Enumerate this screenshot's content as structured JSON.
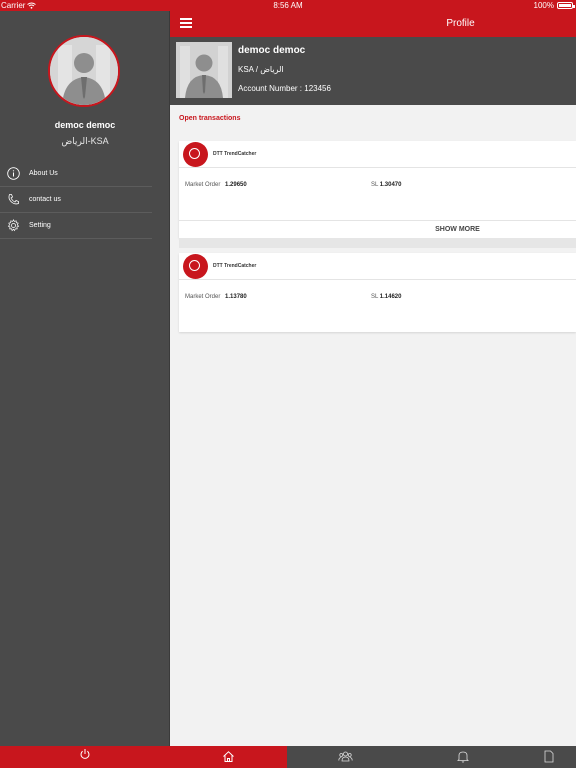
{
  "status_bar": {
    "carrier": "Carrier",
    "time": "8:56 AM",
    "battery": "100%"
  },
  "sidebar": {
    "user_name": "democ democ",
    "location": "الرياض-KSA",
    "menu": [
      {
        "label": "About Us",
        "icon": "info-icon"
      },
      {
        "label": "contact us",
        "icon": "phone-icon"
      },
      {
        "label": "Setting",
        "icon": "gear-icon"
      }
    ],
    "logout_icon": "power-icon"
  },
  "topbar": {
    "title": "Profile",
    "menu_icon": "hamburger-icon"
  },
  "profile": {
    "name": "democ democ",
    "location": "KSA / الرياض",
    "account": "Account Number : 123456"
  },
  "main": {
    "section_title": "Open transactions",
    "transactions": [
      {
        "provider": "DTT TrendCatcher",
        "market_label": "Market Order",
        "market_value": "1.29650",
        "sl_label": "SL",
        "sl_value": "1.30470",
        "show_more": "SHOW MORE"
      },
      {
        "provider": "DTT TrendCatcher",
        "market_label": "Market Order",
        "market_value": "1.13780",
        "sl_label": "SL",
        "sl_value": "1.14620"
      }
    ]
  },
  "tabs": [
    {
      "icon": "home-icon",
      "active": true
    },
    {
      "icon": "group-icon",
      "active": false
    },
    {
      "icon": "bell-icon",
      "active": false
    },
    {
      "icon": "document-icon",
      "active": false
    }
  ],
  "colors": {
    "accent": "#c8161d",
    "dark": "#4a4a4a",
    "background": "#f2f2f2"
  }
}
